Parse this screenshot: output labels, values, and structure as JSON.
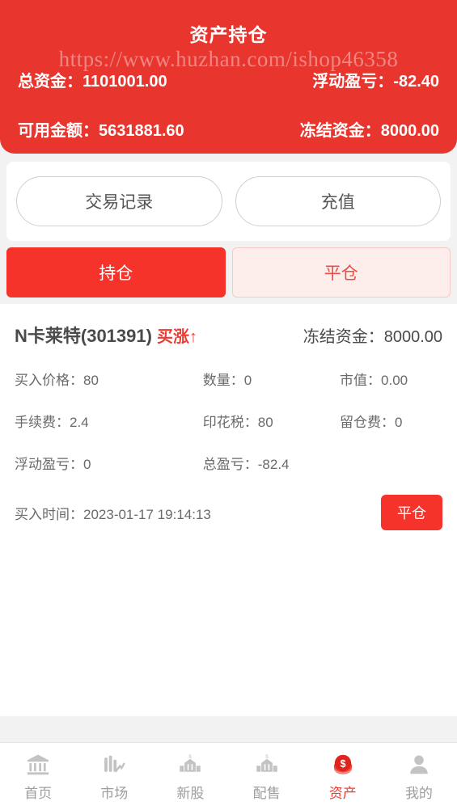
{
  "header": {
    "title": "资产持仓",
    "watermark": "https://www.huzhan.com/ishop46358",
    "brand_color": "#e8352e",
    "stats": [
      {
        "label": "总资金：",
        "value": "1101001.00"
      },
      {
        "label": "浮动盈亏：",
        "value": "-82.40"
      },
      {
        "label": "可用金额：",
        "value": "5631881.60"
      },
      {
        "label": "冻结资金：",
        "value": "8000.00"
      }
    ]
  },
  "actions": {
    "trade_record": "交易记录",
    "recharge": "充值"
  },
  "tabs": [
    {
      "label": "持仓",
      "active": true
    },
    {
      "label": "平仓",
      "active": false
    }
  ],
  "position": {
    "stock_name": "N卡莱特(301391)",
    "direction": "买涨↑",
    "frozen_label": "冻结资金：",
    "frozen_value": "8000.00",
    "rows": [
      {
        "c1": "买入价格：80",
        "c2": "数量：0",
        "c3": "市值：0.00"
      },
      {
        "c1": "手续费：2.4",
        "c2": "印花税：80",
        "c3": "留仓费：0"
      },
      {
        "c1": "浮动盈亏：0",
        "c2": "总盈亏：-82.4",
        "c3": ""
      }
    ],
    "buy_time": "买入时间：2023-01-17 19:14:13",
    "close_button": "平仓",
    "accent_color": "#f5332b",
    "direction_color": "#ef3b32"
  },
  "bottom_nav": [
    {
      "label": "首页",
      "icon": "bank-icon",
      "active": false
    },
    {
      "label": "市场",
      "icon": "bar-chart-icon",
      "active": false
    },
    {
      "label": "新股",
      "icon": "building-icon",
      "active": false
    },
    {
      "label": "配售",
      "icon": "building-icon",
      "active": false
    },
    {
      "label": "资产",
      "icon": "coin-dollar-icon",
      "active": true
    },
    {
      "label": "我的",
      "icon": "person-icon",
      "active": false
    }
  ]
}
